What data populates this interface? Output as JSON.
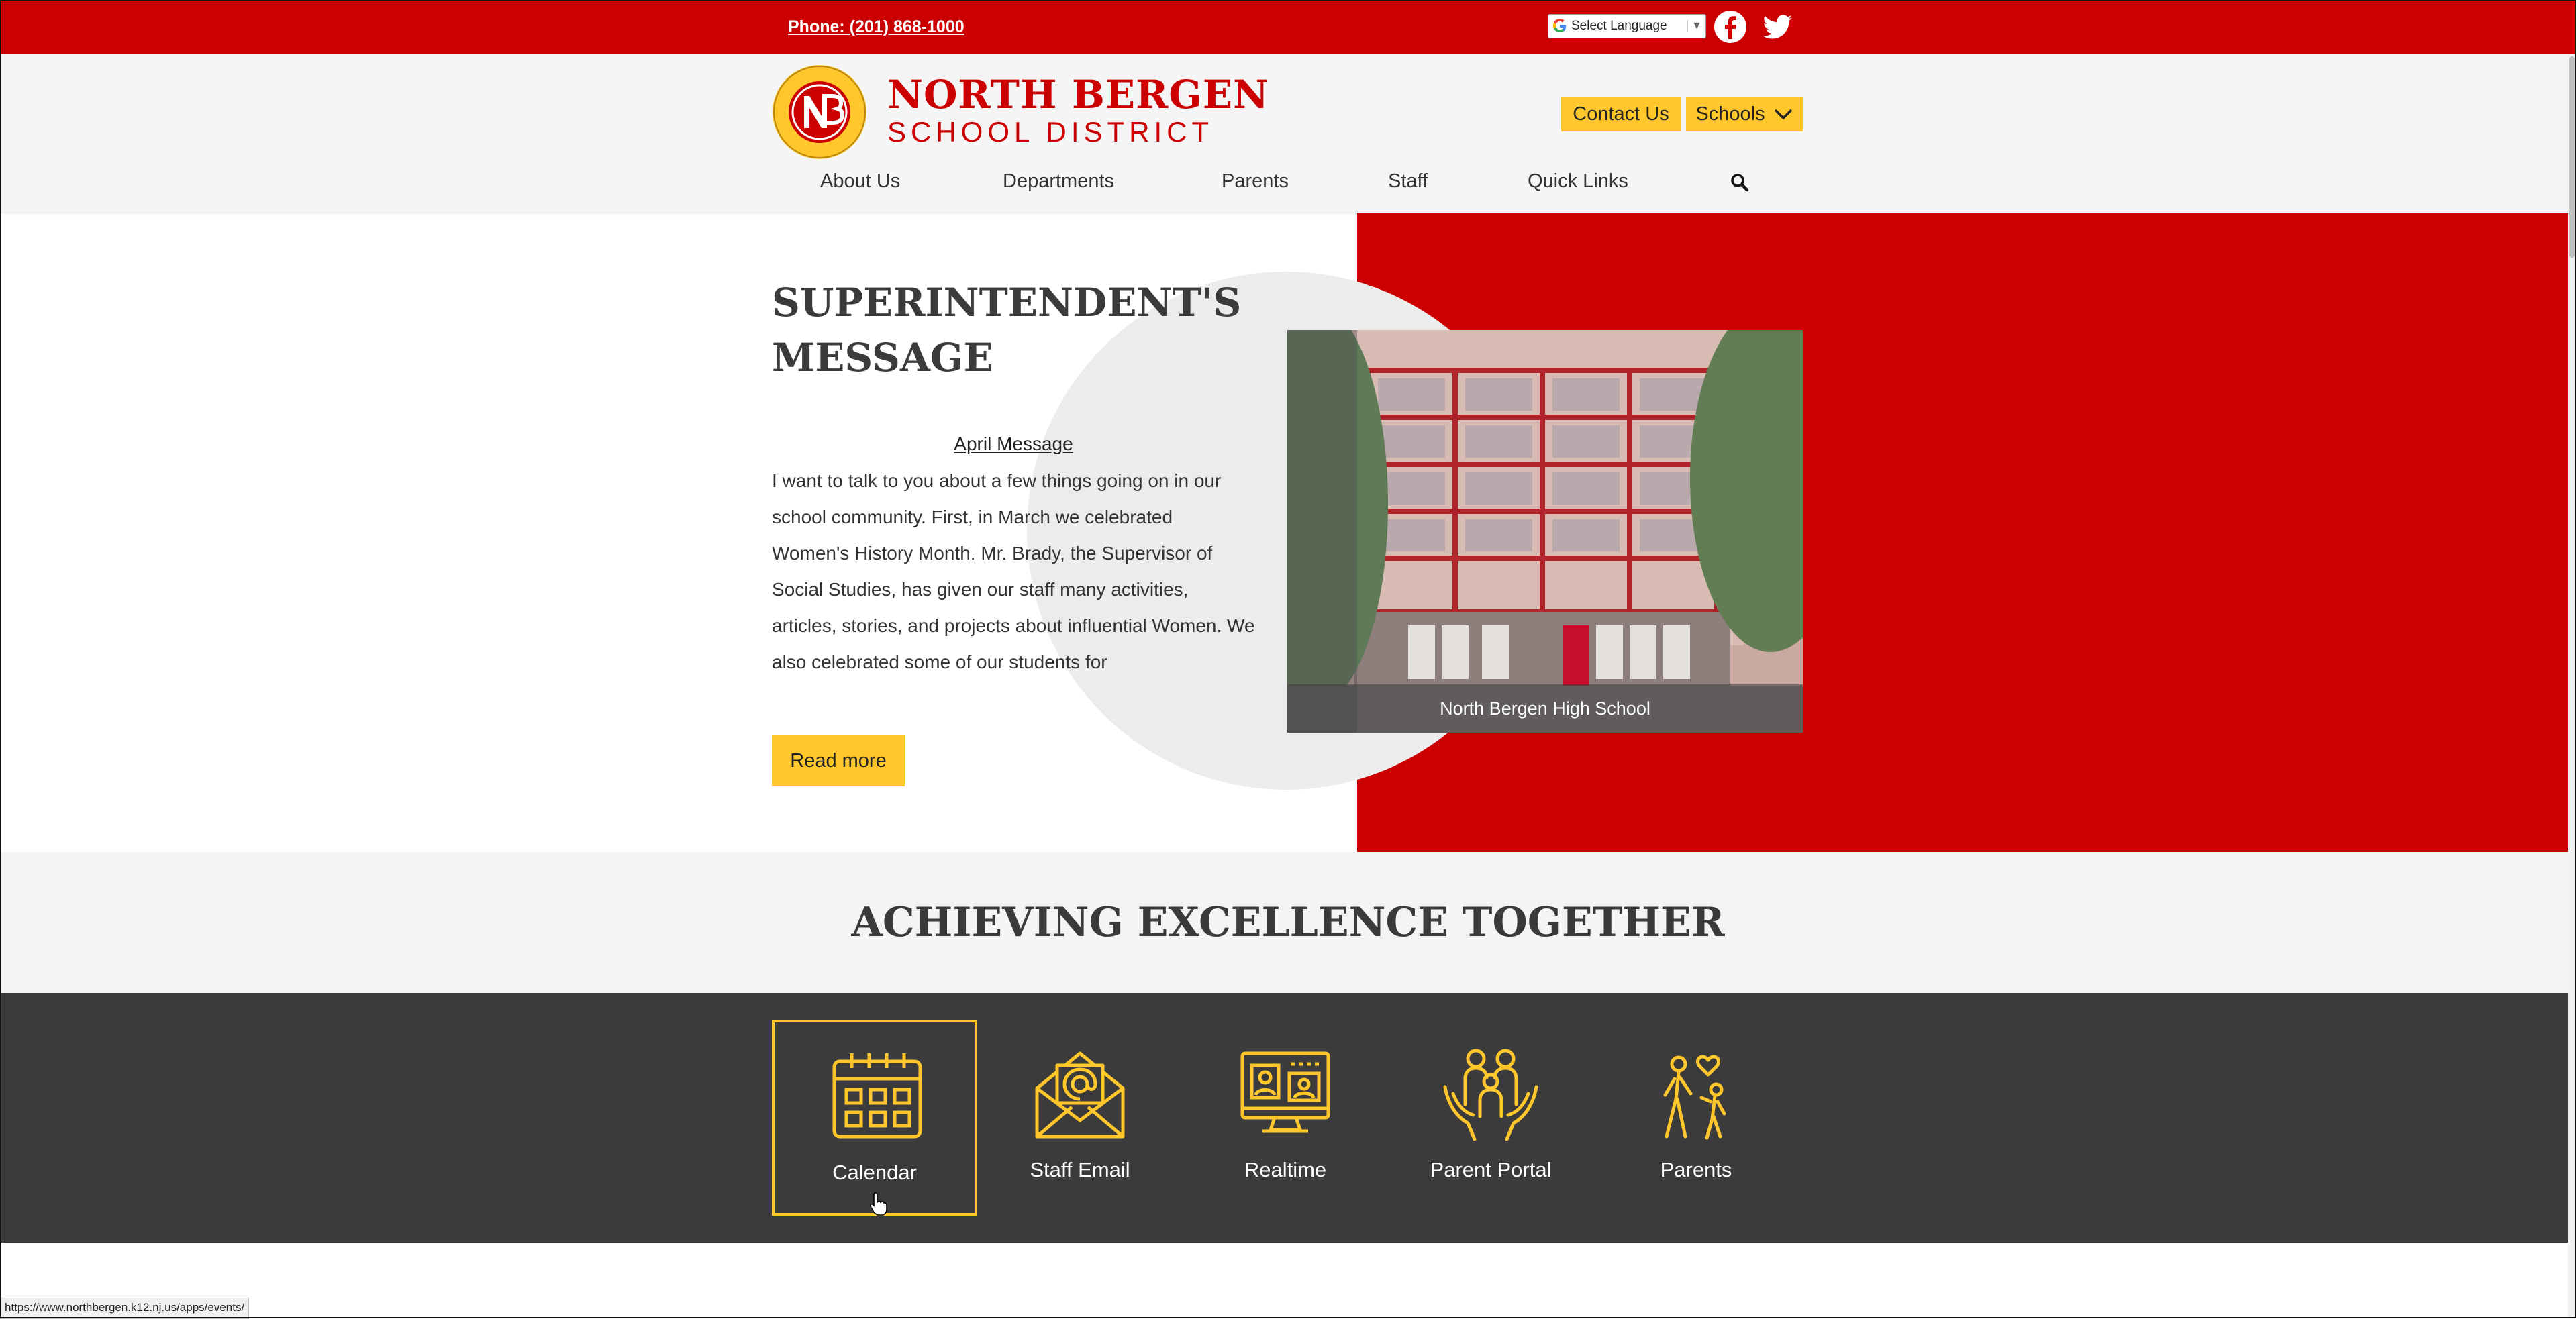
{
  "topbar": {
    "phone": "Phone: (201) 868-1000",
    "language_label": "Select Language",
    "social": [
      "facebook-icon",
      "twitter-icon"
    ]
  },
  "header": {
    "brand_line1": "NORTH BERGEN",
    "brand_line2": "SCHOOL DISTRICT",
    "contact_label": "Contact Us",
    "schools_label": "Schools",
    "nav": [
      "About Us",
      "Departments",
      "Parents",
      "Staff",
      "Quick Links"
    ]
  },
  "hero": {
    "title": "SUPERINTENDENT'S MESSAGE",
    "subtitle": "April Message",
    "body": "I want to talk to you about a few things going on in our school community. First, in March we celebrated Women's History Month. Mr. Brady, the Supervisor of Social Studies, has given our staff many activities, articles, stories, and projects about influential Women. We also celebrated some of our students for",
    "read_more": "Read more",
    "photo_caption": "North Bergen High School"
  },
  "tagline": "ACHIEVING EXCELLENCE TOGETHER",
  "quick_links": [
    {
      "label": "Calendar",
      "icon": "calendar-icon"
    },
    {
      "label": "Staff Email",
      "icon": "email-icon"
    },
    {
      "label": "Realtime",
      "icon": "monitor-icon"
    },
    {
      "label": "Parent Portal",
      "icon": "family-icon"
    },
    {
      "label": "Parents",
      "icon": "parents-icon"
    }
  ],
  "status_url": "https://www.northbergen.k12.nj.us/apps/events/",
  "colors": {
    "brand_red": "#cc0000",
    "accent_yellow": "#ffc72c",
    "dark_band": "#3b3b3b"
  }
}
